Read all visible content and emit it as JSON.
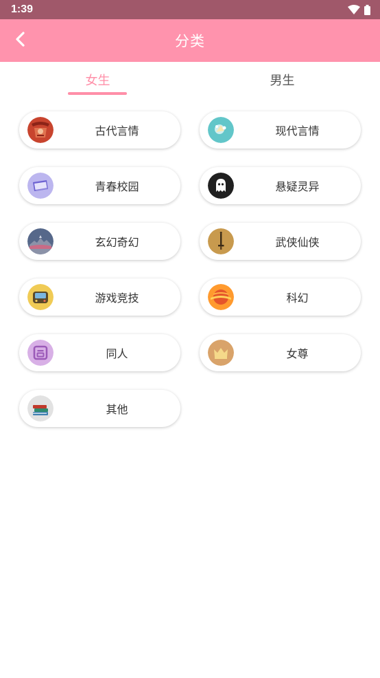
{
  "status_bar": {
    "time": "1:39",
    "icons": [
      "wifi-icon",
      "battery-icon"
    ]
  },
  "header": {
    "title": "分类",
    "back_icon": "chevron-left-icon"
  },
  "tabs": [
    {
      "label": "女生",
      "selected": true
    },
    {
      "label": "男生",
      "selected": false
    }
  ],
  "categories": [
    {
      "label": "古代言情",
      "icon": "ancient-romance-icon"
    },
    {
      "label": "现代言情",
      "icon": "modern-romance-icon"
    },
    {
      "label": "青春校园",
      "icon": "campus-icon"
    },
    {
      "label": "悬疑灵异",
      "icon": "ghost-icon"
    },
    {
      "label": "玄幻奇幻",
      "icon": "fantasy-icon"
    },
    {
      "label": "武侠仙侠",
      "icon": "sword-icon"
    },
    {
      "label": "游戏竞技",
      "icon": "game-controller-icon"
    },
    {
      "label": "科幻",
      "icon": "planet-icon"
    },
    {
      "label": "同人",
      "icon": "fan-fiction-icon"
    },
    {
      "label": "女尊",
      "icon": "crown-icon"
    },
    {
      "label": "其他",
      "icon": "books-icon"
    }
  ],
  "colors": {
    "status_bar": "#a0586a",
    "header": "#ff93ad",
    "accent": "#ff8fa8"
  }
}
